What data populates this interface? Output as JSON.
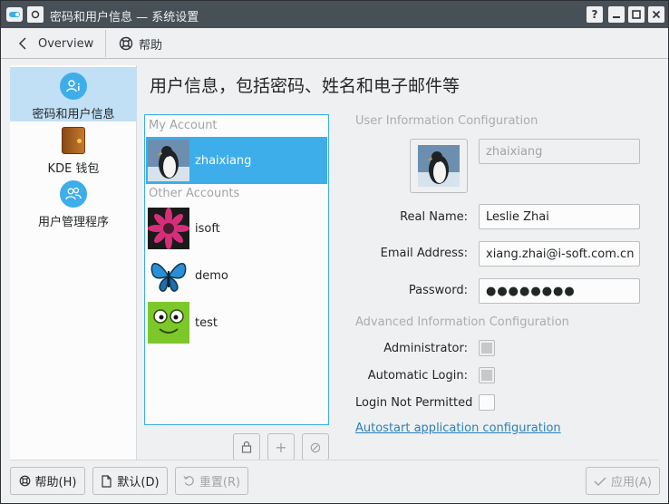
{
  "window": {
    "title": "密码和用户信息 — 系统设置",
    "controls": {
      "help": "?",
      "minimize": "─",
      "maximize": "☐",
      "close": "✕"
    }
  },
  "toolbar": {
    "overview_label": "Overview",
    "help_label": "帮助"
  },
  "sidebar": {
    "items": [
      {
        "label": "密码和用户信息",
        "icon": "user-info-icon",
        "active": true
      },
      {
        "label": "KDE 钱包",
        "icon": "wallet-icon",
        "active": false
      },
      {
        "label": "用户管理程序",
        "icon": "user-manager-icon",
        "active": false
      }
    ]
  },
  "main": {
    "heading": "用户信息，包括密码、姓名和电子邮件等"
  },
  "accounts": {
    "my_account_label": "My Account",
    "other_accounts_label": "Other Accounts",
    "my_account": {
      "name": "zhaixiang",
      "avatar": "penguin"
    },
    "others": [
      {
        "name": "isoft",
        "avatar": "flower"
      },
      {
        "name": "demo",
        "avatar": "butterfly"
      },
      {
        "name": "test",
        "avatar": "green-face"
      }
    ],
    "buttons": {
      "lock": "lock-icon",
      "add": "+",
      "remove": "⊘"
    }
  },
  "user_info": {
    "section_title": "User Information Configuration",
    "username": "zhaixiang",
    "real_name_label": "Real Name:",
    "real_name": "Leslie Zhai",
    "email_label": "Email Address:",
    "email": "xiang.zhai@i-soft.com.cn",
    "password_label": "Password:",
    "password": "●●●●●●●●"
  },
  "advanced": {
    "section_title": "Advanced Information Configuration",
    "administrator_label": "Administrator:",
    "auto_login_label": "Automatic Login:",
    "login_not_permitted_label": "Login Not Permitted",
    "autostart_link": "Autostart application configuration"
  },
  "footer": {
    "help": "帮助(H)",
    "defaults": "默认(D)",
    "reset": "重置(R)",
    "apply": "应用(A)"
  },
  "colors": {
    "accent": "#3daee9",
    "titlebar": "#475057",
    "window_bg": "#eff0f1",
    "selection_bg": "#c2e0f5",
    "link": "#2980b9"
  }
}
